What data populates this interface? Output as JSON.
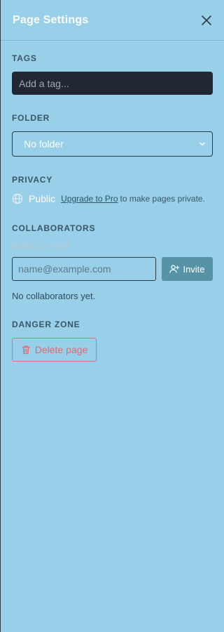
{
  "header": {
    "title": "Page Settings",
    "close_icon": "close-icon"
  },
  "tags": {
    "label": "TAGS",
    "placeholder": "Add a tag..."
  },
  "folder": {
    "label": "FOLDER",
    "selected": "No folder"
  },
  "privacy": {
    "label": "PRIVACY",
    "status": "Public",
    "upgrade_link": "Upgrade to Pro",
    "upgrade_suffix": "to make pages private."
  },
  "collaborators": {
    "label": "COLLABORATORS",
    "hint": "Invite by email",
    "email_placeholder": "name@example.com",
    "invite_label": "Invite",
    "empty_text": "No collaborators yet."
  },
  "danger": {
    "label": "DANGER ZONE",
    "delete_label": "Delete page"
  },
  "colors": {
    "background": "#98cfe9",
    "invite_button": "#5693a6",
    "danger": "#e06a70",
    "tag_input_bg": "#222831"
  }
}
